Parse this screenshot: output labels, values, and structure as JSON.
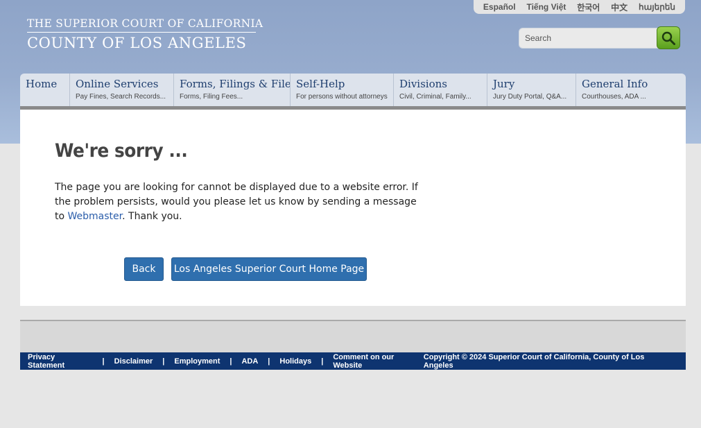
{
  "header": {
    "logo_line1": "THE SUPERIOR COURT OF CALIFORNIA",
    "logo_line2": "COUNTY OF LOS ANGELES",
    "languages": [
      "Español",
      "Tiếng Việt",
      "한국어",
      "中文",
      "հայերեն"
    ],
    "search_placeholder": "Search",
    "search_icon": "magnifier-icon"
  },
  "nav": [
    {
      "title": "Home",
      "sub": ""
    },
    {
      "title": "Online Services",
      "sub": "Pay Fines, Search Records..."
    },
    {
      "title": "Forms, Filings & Files",
      "sub": "Forms, Filing Fees..."
    },
    {
      "title": "Self-Help",
      "sub": "For persons without attorneys"
    },
    {
      "title": "Divisions",
      "sub": "Civil, Criminal, Family..."
    },
    {
      "title": "Jury",
      "sub": "Jury Duty Portal, Q&A..."
    },
    {
      "title": "General Info",
      "sub": "Courthouses, ADA ..."
    }
  ],
  "main": {
    "title": "We're sorry ...",
    "text_before": "The page you are looking for cannot be displayed due to a website error. If the problem persists, would you please let us know by sending a message to ",
    "link": "Webmaster",
    "text_after": ". Thank you.",
    "back_label": "Back",
    "home_label": "Los Angeles Superior Court Home Page"
  },
  "footer": {
    "links": [
      "Privacy Statement",
      "Disclaimer",
      "Employment",
      "ADA",
      "Holidays",
      "Comment on our Website"
    ],
    "separator": "|",
    "copyright": "Copyright © 2024 Superior Court of California, County of Los Angeles"
  },
  "colors": {
    "header_blue": "#8ea4c8",
    "nav_bg": "#dde3ec",
    "button_blue": "#2f6fae",
    "footer_navy": "#0e3470",
    "search_green": "#5aa01e"
  }
}
